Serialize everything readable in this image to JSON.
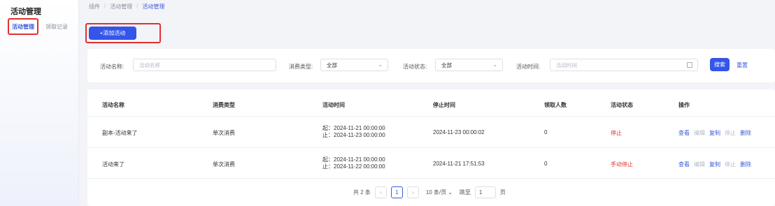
{
  "sidebar": {
    "app_title": "活动管理",
    "tabs": [
      {
        "label": "活动管理",
        "active": true
      },
      {
        "label": "领取记录",
        "active": false
      }
    ]
  },
  "breadcrumb": [
    "插件",
    "活动管理",
    "活动管理"
  ],
  "toolbar": {
    "add_label": "+添加活动"
  },
  "filters": {
    "name_label": "活动名称:",
    "name_placeholder": "活动名称",
    "type_label": "消费类型:",
    "type_value": "全部",
    "status_label": "活动状态:",
    "status_value": "全部",
    "time_label": "活动时间:",
    "time_placeholder": "活动时间",
    "search_label": "搜索",
    "reset_label": "重置"
  },
  "table": {
    "headers": [
      "活动名称",
      "消费类型",
      "活动时间",
      "停止时间",
      "领取人数",
      "活动状态",
      "操作"
    ],
    "rows": [
      {
        "name": "副本-活动来了",
        "type": "单次消费",
        "start": "起：2024-11-21 00:00:00",
        "end": "止：2024-11-23 00:00:00",
        "stop_time": "2024-11-23 00:00:02",
        "count": "0",
        "status": "停止",
        "ops": [
          "查看",
          "编辑",
          "复制",
          "停止",
          "删除"
        ]
      },
      {
        "name": "活动来了",
        "type": "单次消费",
        "start": "起：2024-11-21 00:00:00",
        "end": "止：2024-11-22 00:00:00",
        "stop_time": "2024-11-21 17:51:53",
        "count": "0",
        "status": "手动停止",
        "ops": [
          "查看",
          "编辑",
          "复制",
          "停止",
          "删除"
        ]
      }
    ]
  },
  "pagination": {
    "total": "共 2 条",
    "current_page": "1",
    "page_size": "10 条/页",
    "jump_label": "跳至",
    "jump_value": "1",
    "page_suffix": "页"
  },
  "colors": {
    "accent": "#3355e8",
    "danger": "#e03131",
    "highlight_box": "#e03131"
  }
}
